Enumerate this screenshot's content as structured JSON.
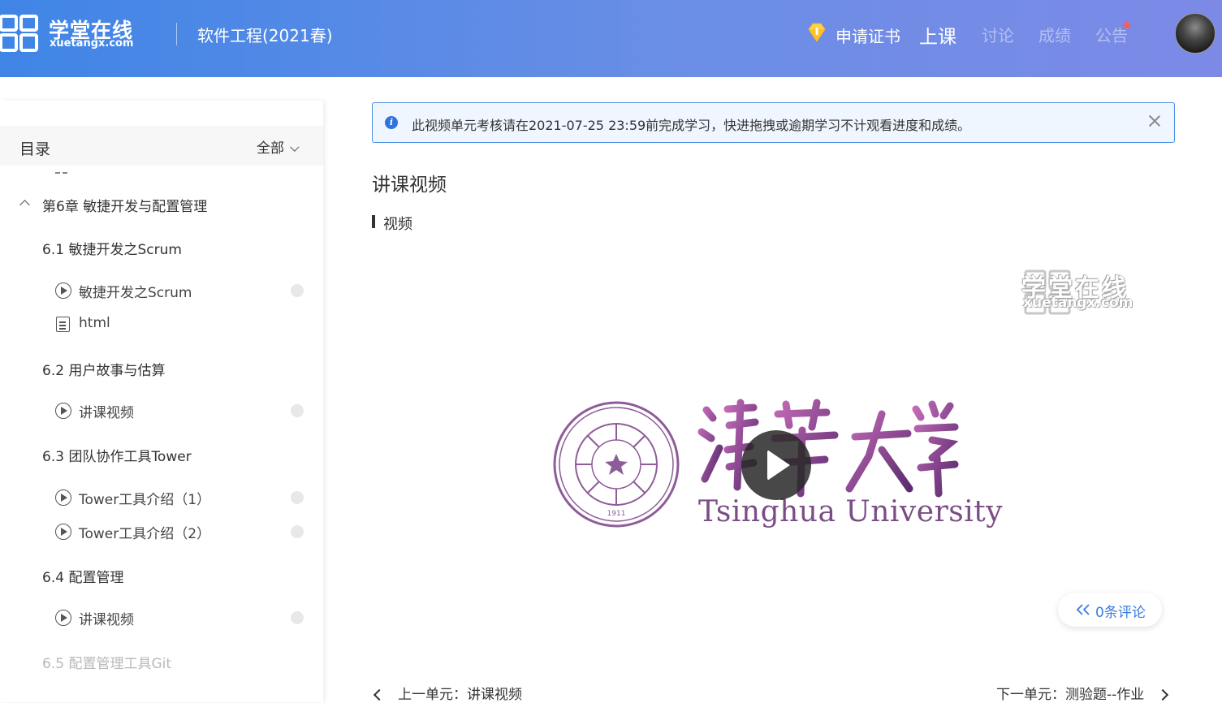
{
  "header": {
    "logo_cn": "学堂在线",
    "logo_en": "xuetangx.com",
    "course_title": "软件工程(2021春)",
    "cert_label": "申请证书",
    "nav": [
      {
        "label": "上课",
        "active": true
      },
      {
        "label": "讨论",
        "active": false
      },
      {
        "label": "成绩",
        "active": false
      },
      {
        "label": "公告",
        "active": false,
        "has_dot": true
      }
    ]
  },
  "sidebar": {
    "title": "目录",
    "filter": "全部",
    "chapter": "第6章 敏捷开发与配置管理",
    "sections": [
      {
        "label": "6.1 敏捷开发之Scrum",
        "lessons": [
          {
            "icon": "play-circle-icon",
            "label": "敏捷开发之Scrum",
            "has_dot": true
          },
          {
            "icon": "document-icon",
            "label": "html",
            "has_dot": false
          }
        ]
      },
      {
        "label": "6.2 用户故事与估算",
        "lessons": [
          {
            "icon": "play-circle-icon",
            "label": "讲课视频",
            "has_dot": true
          }
        ]
      },
      {
        "label": "6.3 团队协作工具Tower",
        "lessons": [
          {
            "icon": "play-circle-icon",
            "label": "Tower工具介绍（1）",
            "has_dot": true
          },
          {
            "icon": "play-circle-icon",
            "label": "Tower工具介绍（2）",
            "has_dot": true
          }
        ]
      },
      {
        "label": "6.4 配置管理",
        "lessons": [
          {
            "icon": "play-circle-icon",
            "label": "讲课视频",
            "has_dot": true
          }
        ]
      },
      {
        "label": "6.5 配置管理工具Git",
        "lessons": []
      }
    ]
  },
  "main": {
    "alert": "此视频单元考核请在2021-07-25 23:59前完成学习，快进拖拽或逾期学习不计观看进度和成绩。",
    "title": "讲课视频",
    "subtitle": "视频",
    "video": {
      "watermark_cn": "学堂在线",
      "watermark_en": "xuetangx.com",
      "seal_year": "1911",
      "university_en": "Tsinghua University"
    },
    "comments": "0条评论",
    "prev": "上一单元：讲课视频",
    "next": "下一单元：测验题--作业"
  },
  "colors": {
    "header_start": "#3f85e6",
    "header_end": "#7c8ae6",
    "accent": "#3b7be0",
    "seal_purple": "#7a4d86",
    "notice_dot": "#ff5a5a"
  }
}
